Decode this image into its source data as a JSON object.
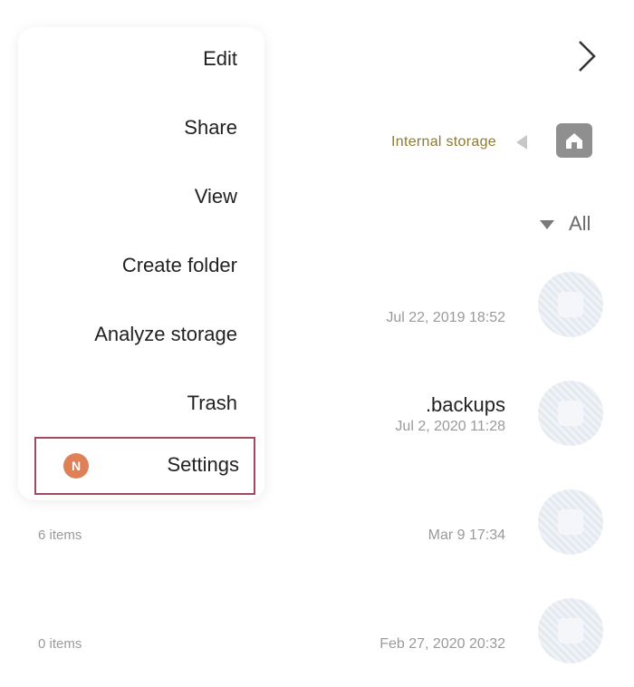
{
  "header": {
    "storage_label": "Internal storage",
    "filter_label": "All"
  },
  "menu": {
    "items": [
      {
        "label": "Edit"
      },
      {
        "label": "Share"
      },
      {
        "label": "View"
      },
      {
        "label": "Create folder"
      },
      {
        "label": "Analyze storage"
      },
      {
        "label": "Trash"
      }
    ],
    "settings": {
      "label": "Settings",
      "badge": "N"
    }
  },
  "files": [
    {
      "name": "",
      "date": "Jul 22, 2019 18:52",
      "count": ""
    },
    {
      "name": ".backups",
      "date": "Jul 2, 2020 11:28",
      "count": ""
    },
    {
      "name": "",
      "date": "Mar 9 17:34",
      "count": "6 items"
    },
    {
      "name": "",
      "date": "Feb 27, 2020 20:32",
      "count": "0 items"
    }
  ],
  "icons": {
    "back": "chevron-icon",
    "home": "home-icon",
    "breadcrumb": "triangle-left-icon",
    "filter": "triangle-down-icon",
    "folder": "folder-icon"
  },
  "colors": {
    "accent_badge": "#de8058",
    "highlight_border": "#a04a60",
    "storage_text": "#8a7a33"
  }
}
